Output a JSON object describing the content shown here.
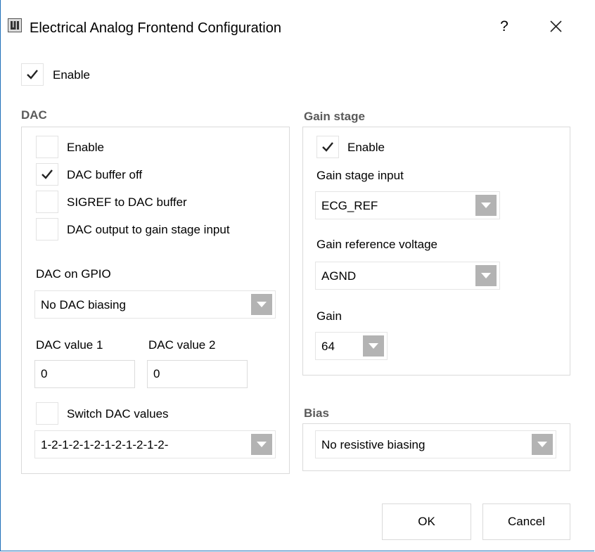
{
  "window": {
    "title": "Electrical Analog Frontend Configuration",
    "help_label": "?"
  },
  "top_enable": {
    "label": "Enable",
    "checked": true
  },
  "dac": {
    "section_title": "DAC",
    "enable": {
      "label": "Enable",
      "checked": false
    },
    "buffer_off": {
      "label": "DAC buffer off",
      "checked": true
    },
    "sigref": {
      "label": "SIGREF to DAC buffer",
      "checked": false
    },
    "output_to_gain": {
      "label": "DAC output to gain stage input",
      "checked": false
    },
    "gpio_label": "DAC on GPIO",
    "gpio_selected": "No DAC biasing",
    "value1_label": "DAC value 1",
    "value2_label": "DAC value 2",
    "value1": "0",
    "value2": "0",
    "switch": {
      "label": "Switch DAC values",
      "checked": false
    },
    "pattern_selected": "1-2-1-2-1-2-1-2-1-2-1-2-"
  },
  "gain_stage": {
    "section_title": "Gain stage",
    "enable": {
      "label": "Enable",
      "checked": true
    },
    "input_label": "Gain stage input",
    "input_selected": "ECG_REF",
    "ref_label": "Gain reference voltage",
    "ref_selected": "AGND",
    "gain_label": "Gain",
    "gain_selected": "64"
  },
  "bias": {
    "section_title": "Bias",
    "selected": "No resistive biasing"
  },
  "buttons": {
    "ok": "OK",
    "cancel": "Cancel"
  },
  "colors": {
    "border": "#dadada",
    "arrow_box": "#b3b3b3",
    "section_text": "#5a5a5a",
    "window_edge": "#1f6fb8"
  },
  "icons": {
    "check": "checkmark-icon",
    "dropdown": "chevron-down-icon",
    "close": "close-icon",
    "app": "app-icon"
  }
}
